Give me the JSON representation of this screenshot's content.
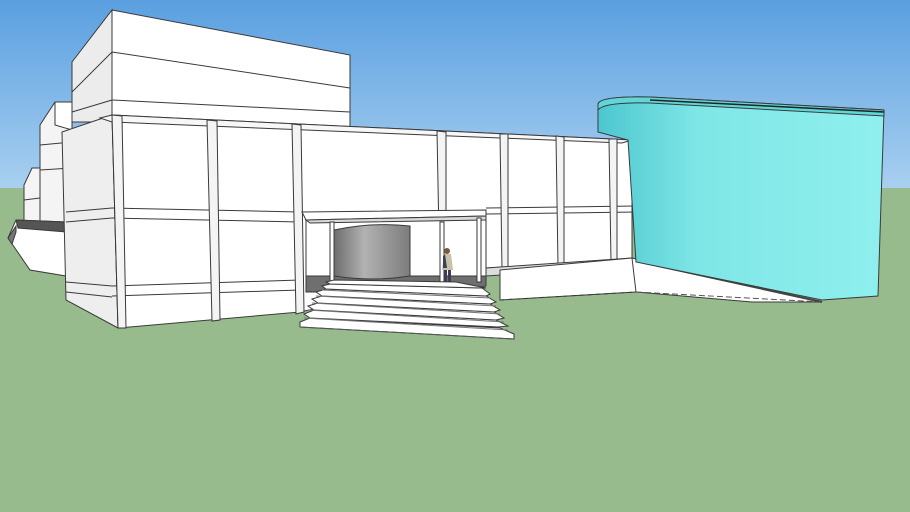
{
  "scene": {
    "kind": "3d-architectural-model",
    "colors": {
      "sky_top": "#5a9fe0",
      "sky_bottom": "#a9d0f0",
      "ground": "#97bb8d",
      "wall": "#ffffff",
      "wall_shade": "#ececec",
      "edge": "#3a3a3a",
      "rotunda": "#7fe6e6",
      "rotunda_dark": "#4cc7cf",
      "dark_cylinder": "#9a9a9a",
      "plaza": "#6f6f6f"
    },
    "elements": [
      "sky",
      "ground-plane",
      "rear-tall-block",
      "rear-stepped-blocks",
      "main-facade",
      "entrance-canopy",
      "entrance-cylinder",
      "entrance-stairs",
      "human-figure",
      "cyan-rotunda",
      "ramp-terrace"
    ]
  }
}
